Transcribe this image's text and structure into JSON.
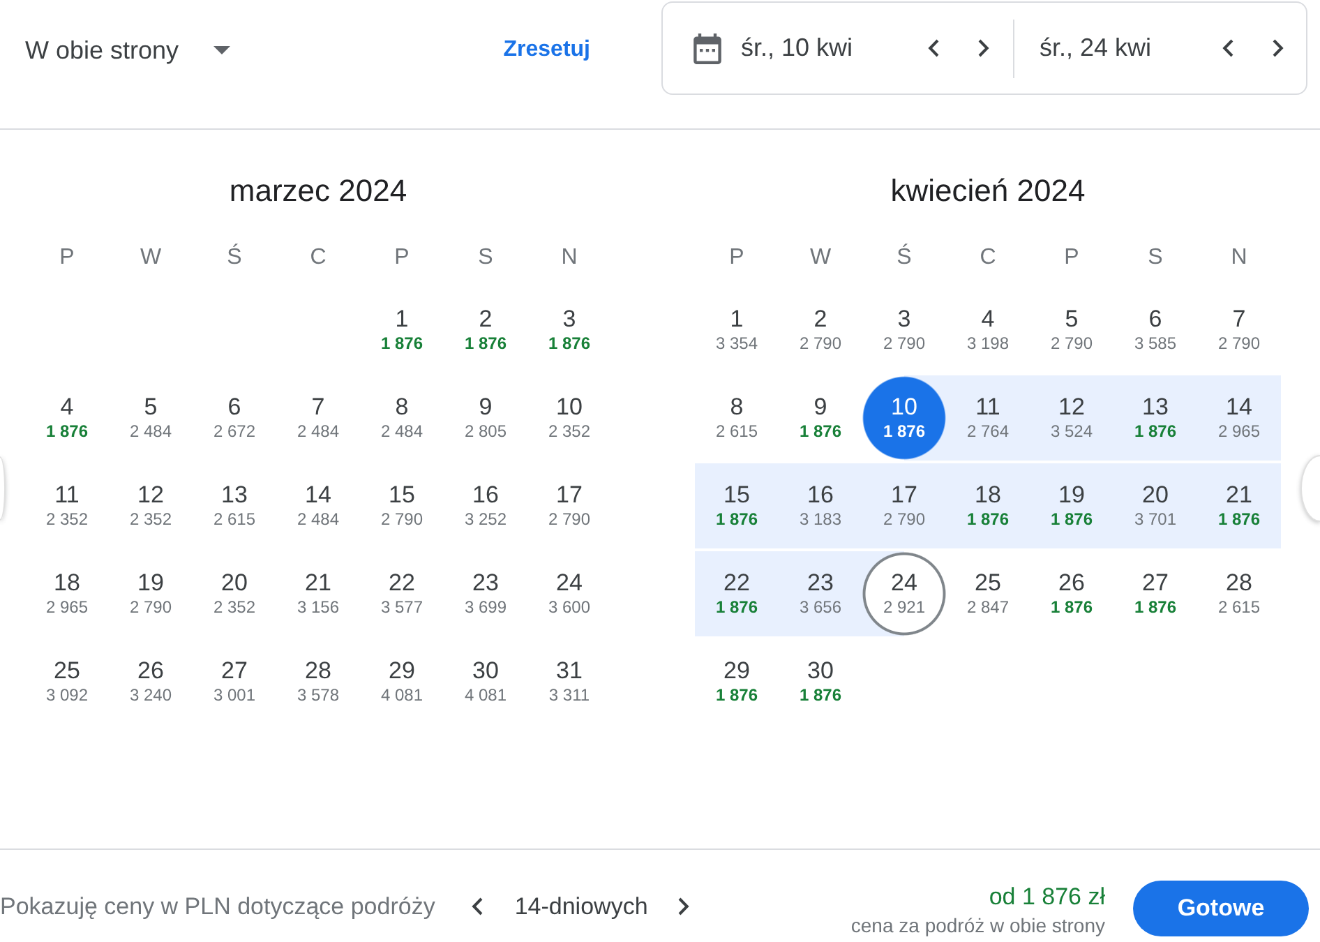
{
  "trip_type": {
    "label": "W obie strony"
  },
  "reset": {
    "label": "Zresetuj"
  },
  "date_range": {
    "departure": "śr., 10 kwi",
    "return": "śr., 24 kwi"
  },
  "months": [
    {
      "title": "marzec 2024",
      "weekdays": [
        "P",
        "W",
        "Ś",
        "C",
        "P",
        "S",
        "N"
      ],
      "weeks": [
        [
          {
            "day": "1",
            "price": "1 876",
            "low_price": true,
            "in_range": false,
            "selected": false,
            "kind": "day"
          },
          {
            "day": "2",
            "price": "1 876",
            "low_price": true,
            "in_range": false,
            "selected": false,
            "kind": "day"
          },
          {
            "day": "3",
            "price": "1 876",
            "low_price": true,
            "in_range": false,
            "selected": false,
            "kind": "day"
          }
        ],
        [
          {
            "day": "4",
            "price": "1 876",
            "low_price": true,
            "in_range": false,
            "selected": false,
            "kind": "day"
          },
          {
            "day": "5",
            "price": "2 484",
            "low_price": false,
            "in_range": false,
            "selected": false,
            "kind": "day"
          },
          {
            "day": "6",
            "price": "2 672",
            "low_price": false,
            "in_range": false,
            "selected": false,
            "kind": "day"
          },
          {
            "day": "7",
            "price": "2 484",
            "low_price": false,
            "in_range": false,
            "selected": false,
            "kind": "day"
          },
          {
            "day": "8",
            "price": "2 484",
            "low_price": false,
            "in_range": false,
            "selected": false,
            "kind": "day"
          },
          {
            "day": "9",
            "price": "2 805",
            "low_price": false,
            "in_range": false,
            "selected": false,
            "kind": "day"
          },
          {
            "day": "10",
            "price": "2 352",
            "low_price": false,
            "in_range": false,
            "selected": false,
            "kind": "day"
          }
        ],
        [
          {
            "day": "11",
            "price": "2 352",
            "low_price": false,
            "in_range": false,
            "selected": false,
            "kind": "day"
          },
          {
            "day": "12",
            "price": "2 352",
            "low_price": false,
            "in_range": false,
            "selected": false,
            "kind": "day"
          },
          {
            "day": "13",
            "price": "2 615",
            "low_price": false,
            "in_range": false,
            "selected": false,
            "kind": "day"
          },
          {
            "day": "14",
            "price": "2 484",
            "low_price": false,
            "in_range": false,
            "selected": false,
            "kind": "day"
          },
          {
            "day": "15",
            "price": "2 790",
            "low_price": false,
            "in_range": false,
            "selected": false,
            "kind": "day"
          },
          {
            "day": "16",
            "price": "3 252",
            "low_price": false,
            "in_range": false,
            "selected": false,
            "kind": "day"
          },
          {
            "day": "17",
            "price": "2 790",
            "low_price": false,
            "in_range": false,
            "selected": false,
            "kind": "day"
          }
        ],
        [
          {
            "day": "18",
            "price": "2 965",
            "low_price": false,
            "in_range": false,
            "selected": false,
            "kind": "day"
          },
          {
            "day": "19",
            "price": "2 790",
            "low_price": false,
            "in_range": false,
            "selected": false,
            "kind": "day"
          },
          {
            "day": "20",
            "price": "2 352",
            "low_price": false,
            "in_range": false,
            "selected": false,
            "kind": "day"
          },
          {
            "day": "21",
            "price": "3 156",
            "low_price": false,
            "in_range": false,
            "selected": false,
            "kind": "day"
          },
          {
            "day": "22",
            "price": "3 577",
            "low_price": false,
            "in_range": false,
            "selected": false,
            "kind": "day"
          },
          {
            "day": "23",
            "price": "3 699",
            "low_price": false,
            "in_range": false,
            "selected": false,
            "kind": "day"
          },
          {
            "day": "24",
            "price": "3 600",
            "low_price": false,
            "in_range": false,
            "selected": false,
            "kind": "day"
          }
        ],
        [
          {
            "day": "25",
            "price": "3 092",
            "low_price": false,
            "in_range": false,
            "selected": false,
            "kind": "day"
          },
          {
            "day": "26",
            "price": "3 240",
            "low_price": false,
            "in_range": false,
            "selected": false,
            "kind": "day"
          },
          {
            "day": "27",
            "price": "3 001",
            "low_price": false,
            "in_range": false,
            "selected": false,
            "kind": "day"
          },
          {
            "day": "28",
            "price": "3 578",
            "low_price": false,
            "in_range": false,
            "selected": false,
            "kind": "day"
          },
          {
            "day": "29",
            "price": "4 081",
            "low_price": false,
            "in_range": false,
            "selected": false,
            "kind": "day"
          },
          {
            "day": "30",
            "price": "4 081",
            "low_price": false,
            "in_range": false,
            "selected": false,
            "kind": "day"
          },
          {
            "day": "31",
            "price": "3 311",
            "low_price": false,
            "in_range": false,
            "selected": false,
            "kind": "day"
          }
        ]
      ]
    },
    {
      "title": "kwiecień 2024",
      "weekdays": [
        "P",
        "W",
        "Ś",
        "C",
        "P",
        "S",
        "N"
      ],
      "weeks": [
        [
          {
            "day": "1",
            "price": "3 354",
            "low_price": false,
            "in_range": false,
            "selected": false,
            "kind": "day"
          },
          {
            "day": "2",
            "price": "2 790",
            "low_price": false,
            "in_range": false,
            "selected": false,
            "kind": "day"
          },
          {
            "day": "3",
            "price": "2 790",
            "low_price": false,
            "in_range": false,
            "selected": false,
            "kind": "day"
          },
          {
            "day": "4",
            "price": "3 198",
            "low_price": false,
            "in_range": false,
            "selected": false,
            "kind": "day"
          },
          {
            "day": "5",
            "price": "2 790",
            "low_price": false,
            "in_range": false,
            "selected": false,
            "kind": "day"
          },
          {
            "day": "6",
            "price": "3 585",
            "low_price": false,
            "in_range": false,
            "selected": false,
            "kind": "day"
          },
          {
            "day": "7",
            "price": "2 790",
            "low_price": false,
            "in_range": false,
            "selected": false,
            "kind": "day"
          }
        ],
        [
          {
            "day": "8",
            "price": "2 615",
            "low_price": false,
            "in_range": false,
            "selected": false,
            "kind": "day"
          },
          {
            "day": "9",
            "price": "1 876",
            "low_price": true,
            "in_range": false,
            "selected": false,
            "kind": "day"
          },
          {
            "day": "10",
            "price": "1 876",
            "low_price": false,
            "in_range": true,
            "selected": true,
            "kind": "departure"
          },
          {
            "day": "11",
            "price": "2 764",
            "low_price": false,
            "in_range": true,
            "selected": false,
            "kind": "day"
          },
          {
            "day": "12",
            "price": "3 524",
            "low_price": false,
            "in_range": true,
            "selected": false,
            "kind": "day"
          },
          {
            "day": "13",
            "price": "1 876",
            "low_price": true,
            "in_range": true,
            "selected": false,
            "kind": "day"
          },
          {
            "day": "14",
            "price": "2 965",
            "low_price": false,
            "in_range": true,
            "selected": false,
            "kind": "day"
          }
        ],
        [
          {
            "day": "15",
            "price": "1 876",
            "low_price": true,
            "in_range": true,
            "selected": false,
            "kind": "day"
          },
          {
            "day": "16",
            "price": "3 183",
            "low_price": false,
            "in_range": true,
            "selected": false,
            "kind": "day"
          },
          {
            "day": "17",
            "price": "2 790",
            "low_price": false,
            "in_range": true,
            "selected": false,
            "kind": "day"
          },
          {
            "day": "18",
            "price": "1 876",
            "low_price": true,
            "in_range": true,
            "selected": false,
            "kind": "day"
          },
          {
            "day": "19",
            "price": "1 876",
            "low_price": true,
            "in_range": true,
            "selected": false,
            "kind": "day"
          },
          {
            "day": "20",
            "price": "3 701",
            "low_price": false,
            "in_range": true,
            "selected": false,
            "kind": "day"
          },
          {
            "day": "21",
            "price": "1 876",
            "low_price": true,
            "in_range": true,
            "selected": false,
            "kind": "day"
          }
        ],
        [
          {
            "day": "22",
            "price": "1 876",
            "low_price": true,
            "in_range": true,
            "selected": false,
            "kind": "day"
          },
          {
            "day": "23",
            "price": "3 656",
            "low_price": false,
            "in_range": true,
            "selected": false,
            "kind": "day"
          },
          {
            "day": "24",
            "price": "2 921",
            "low_price": false,
            "in_range": true,
            "selected": true,
            "kind": "return"
          },
          {
            "day": "25",
            "price": "2 847",
            "low_price": false,
            "in_range": false,
            "selected": false,
            "kind": "day"
          },
          {
            "day": "26",
            "price": "1 876",
            "low_price": true,
            "in_range": false,
            "selected": false,
            "kind": "day"
          },
          {
            "day": "27",
            "price": "1 876",
            "low_price": true,
            "in_range": false,
            "selected": false,
            "kind": "day"
          },
          {
            "day": "28",
            "price": "2 615",
            "low_price": false,
            "in_range": false,
            "selected": false,
            "kind": "day"
          }
        ],
        [
          {
            "day": "29",
            "price": "1 876",
            "low_price": true,
            "in_range": false,
            "selected": false,
            "kind": "day"
          },
          {
            "day": "30",
            "price": "1 876",
            "low_price": true,
            "in_range": false,
            "selected": false,
            "kind": "day"
          }
        ]
      ]
    }
  ],
  "footer": {
    "note": "Pokazuję ceny w PLN dotyczące podróży",
    "trip_length": "14-dniowych",
    "price": "od 1 876 zł",
    "price_caption": "cena za podróż w obie strony",
    "done_button": "Gotowe"
  }
}
